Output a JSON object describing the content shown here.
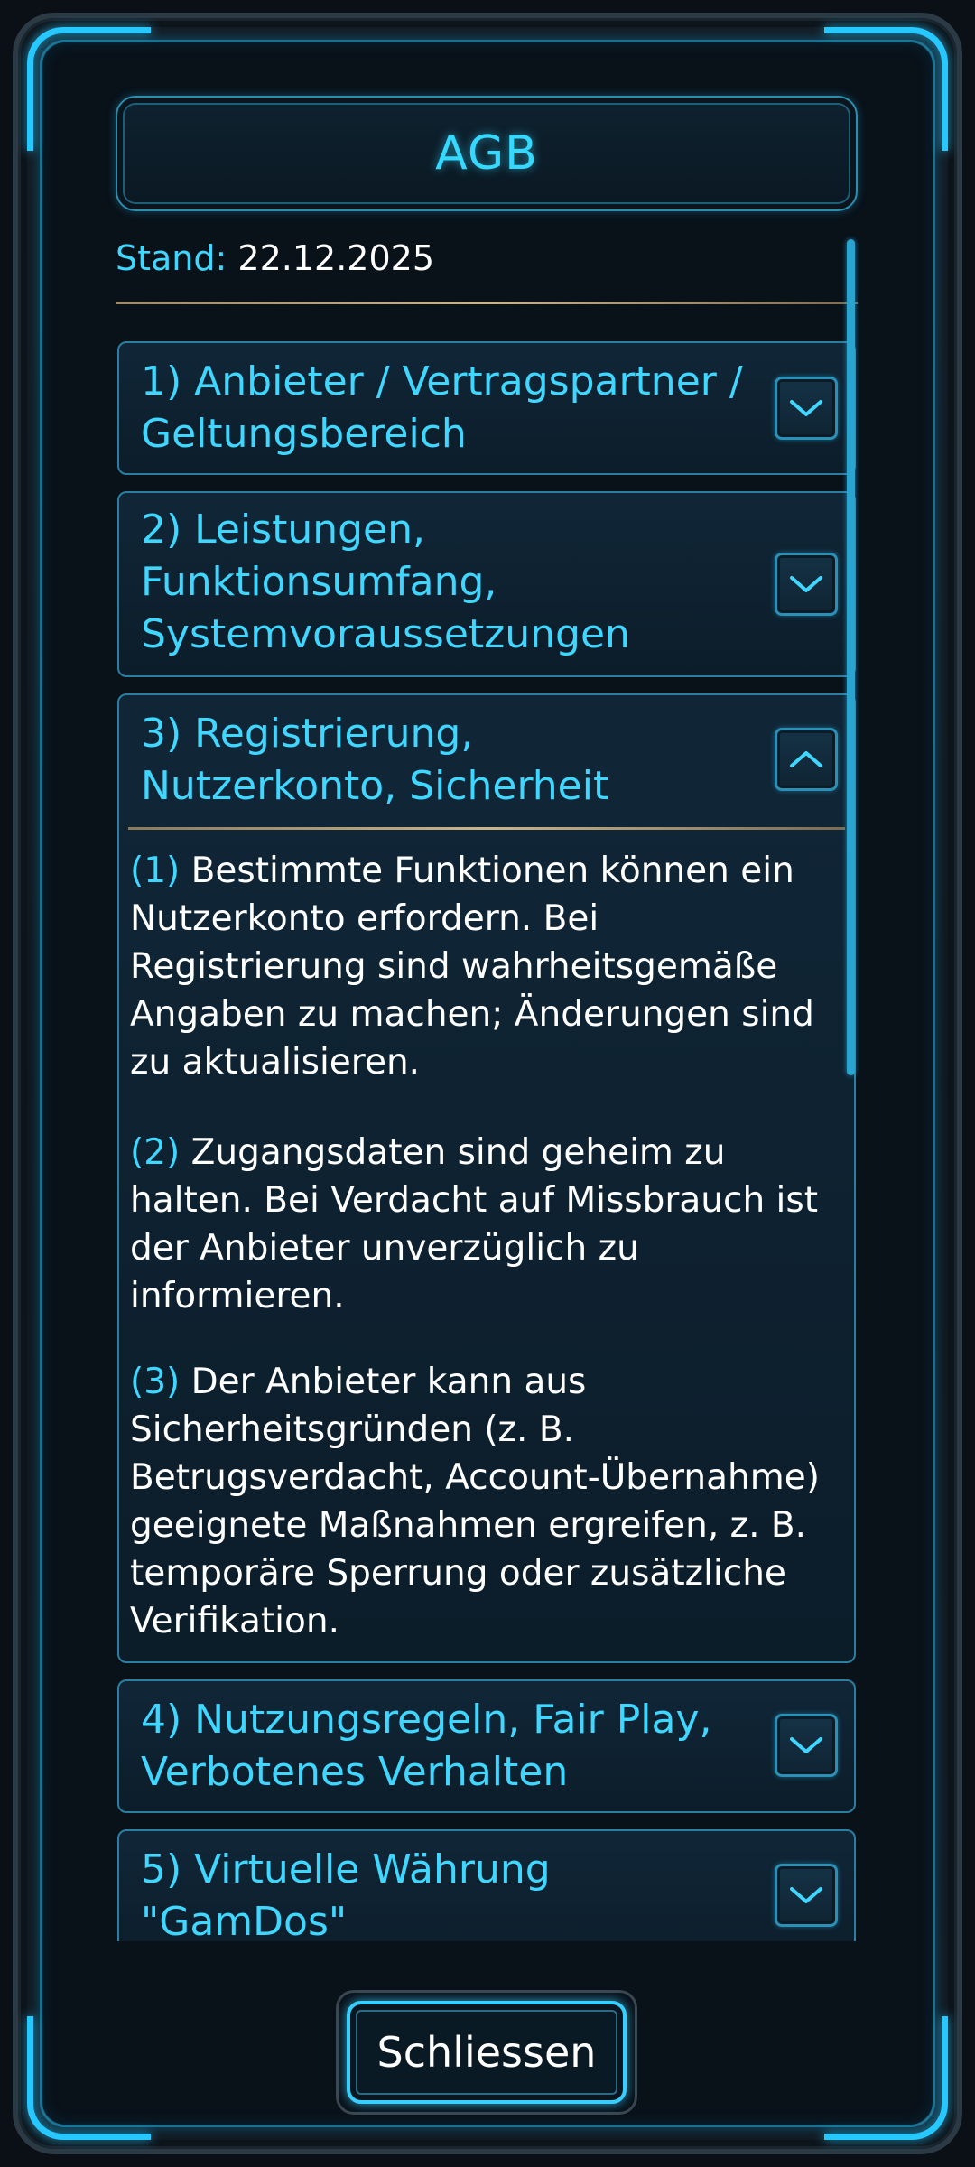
{
  "dialog": {
    "title": "AGB",
    "stand_label": "Stand:",
    "stand_date": "22.12.2025",
    "close_label": "Schliessen"
  },
  "sections": [
    {
      "title_lines": [
        "1) Anbieter / Vertragspartner /",
        "Geltungsbereich"
      ],
      "expanded": false,
      "icon": "chevron-down-icon"
    },
    {
      "title_lines": [
        "2) Leistungen,",
        "Funktionsumfang,",
        "Systemvoraussetzungen"
      ],
      "expanded": false,
      "icon": "chevron-down-icon"
    },
    {
      "title_lines": [
        "3) Registrierung,",
        "Nutzerkonto, Sicherheit"
      ],
      "expanded": true,
      "icon": "chevron-up-icon",
      "paragraphs": [
        {
          "num": "(1)",
          "text_lines": [
            "Bestimmte Funktionen können ein",
            "Nutzerkonto erfordern. Bei",
            "Registrierung sind wahrheitsgemäße",
            "Angaben zu machen; Änderungen sind",
            "zu aktualisieren."
          ]
        },
        {
          "num": "(2)",
          "text_lines": [
            "Zugangsdaten sind geheim zu",
            "halten. Bei Verdacht auf Missbrauch ist",
            "der Anbieter unverzüglich zu",
            "informieren."
          ]
        },
        {
          "num": "(3)",
          "text_lines": [
            "Der Anbieter kann aus",
            "Sicherheitsgründen (z. B.",
            "Betrugsverdacht, Account-Übernahme)",
            "geeignete Maßnahmen ergreifen, z. B.",
            "temporäre Sperrung oder zusätzliche",
            "Verifikation."
          ]
        }
      ]
    },
    {
      "title_lines": [
        "4) Nutzungsregeln, Fair Play,",
        "Verbotenes Verhalten"
      ],
      "expanded": false,
      "icon": "chevron-down-icon"
    },
    {
      "title_lines": [
        "5) Virtuelle Währung",
        "\"GamDos\""
      ],
      "expanded": false,
      "icon": "chevron-down-icon"
    }
  ],
  "colors": {
    "accent": "#3fd6ff",
    "frame_glow": "#27c8ff",
    "divider": "#c9b58d"
  }
}
